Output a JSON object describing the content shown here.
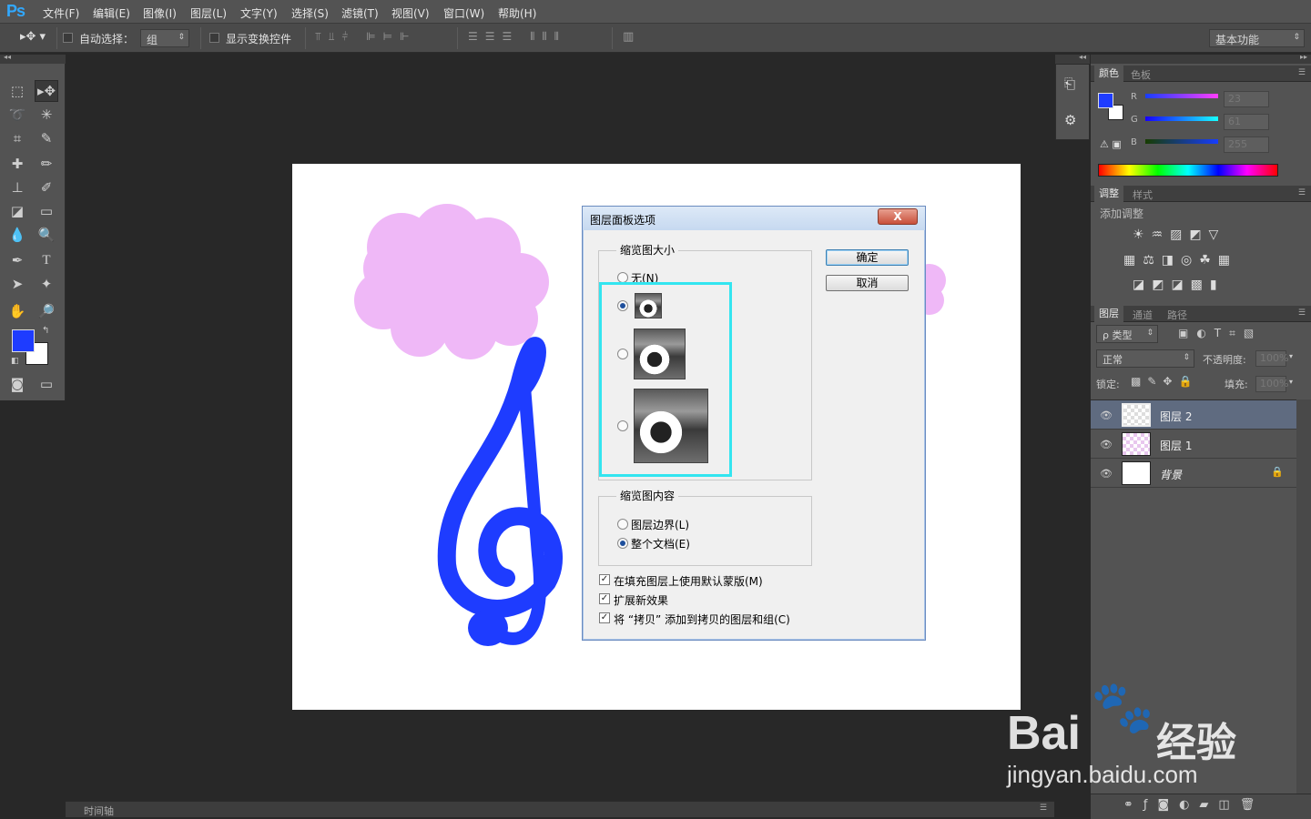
{
  "app": {
    "logo": "Ps"
  },
  "menu": [
    "文件(F)",
    "编辑(E)",
    "图像(I)",
    "图层(L)",
    "文字(Y)",
    "选择(S)",
    "滤镜(T)",
    "视图(V)",
    "窗口(W)",
    "帮助(H)"
  ],
  "options": {
    "auto_select_label": "自动选择：",
    "auto_select_value": "组",
    "show_transform_label": "显示变换控件",
    "workspace": "基本功能"
  },
  "colors": {
    "foreground": "#1e3cff",
    "background": "#ffffff",
    "cloud": "#efb8f7",
    "clef": "#1e3cff",
    "highlight": "#33e5f0"
  },
  "color_panel": {
    "tabs": [
      "颜色",
      "色板"
    ],
    "channels": [
      {
        "label": "R",
        "value": "23"
      },
      {
        "label": "G",
        "value": "61"
      },
      {
        "label": "B",
        "value": "255"
      }
    ]
  },
  "adjust_panel": {
    "tabs": [
      "调整",
      "样式"
    ],
    "title": "添加调整"
  },
  "layers_panel": {
    "tabs": [
      "图层",
      "通道",
      "路径"
    ],
    "filter": "ρ 类型",
    "blend": "正常",
    "opacity_label": "不透明度:",
    "opacity": "100%",
    "lock_label": "锁定:",
    "fill_label": "填充:",
    "fill": "100%",
    "layers": [
      {
        "name": "图层 2"
      },
      {
        "name": "图层 1"
      },
      {
        "name": "背景"
      }
    ]
  },
  "status": {
    "timeline": "时间轴"
  },
  "dialog": {
    "title": "图层面板选项",
    "close": "X",
    "ok": "确定",
    "cancel": "取消",
    "thumb_group": "缩览图大小",
    "thumb_none": "无(N)",
    "content_group": "缩览图内容",
    "content_options": [
      "图层边界(L)",
      "整个文档(E)"
    ],
    "checkboxes": [
      "在填充图层上使用默认蒙版(M)",
      "扩展新效果",
      "将 “拷贝” 添加到拷贝的图层和组(C)"
    ]
  },
  "watermark": {
    "brand": "Bai",
    "brand2": "经验",
    "url": "jingyan.baidu.com"
  }
}
